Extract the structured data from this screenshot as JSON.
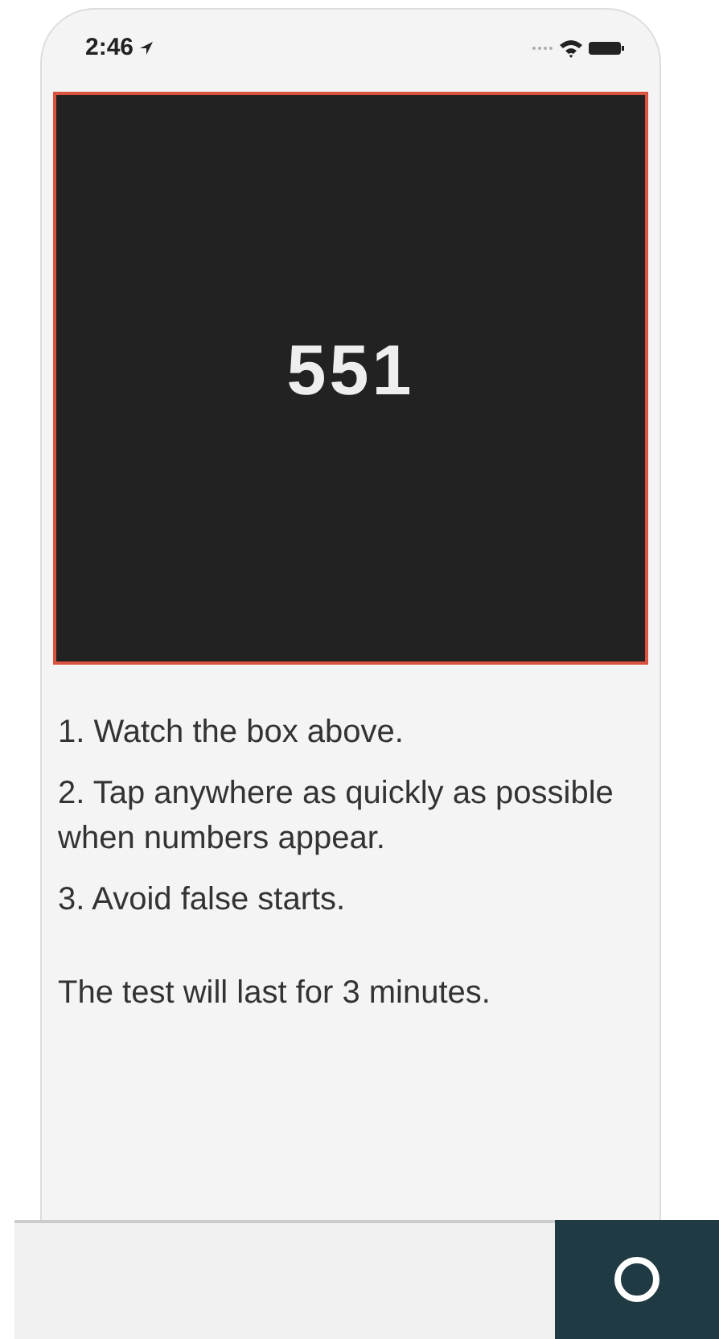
{
  "status_bar": {
    "time": "2:46"
  },
  "stimulus": {
    "number": "551"
  },
  "instructions": [
    "1. Watch the box above.",
    "2. Tap anywhere as quickly as possible when numbers appear.",
    "3. Avoid false starts."
  ],
  "note": "The test will last for 3 minutes."
}
